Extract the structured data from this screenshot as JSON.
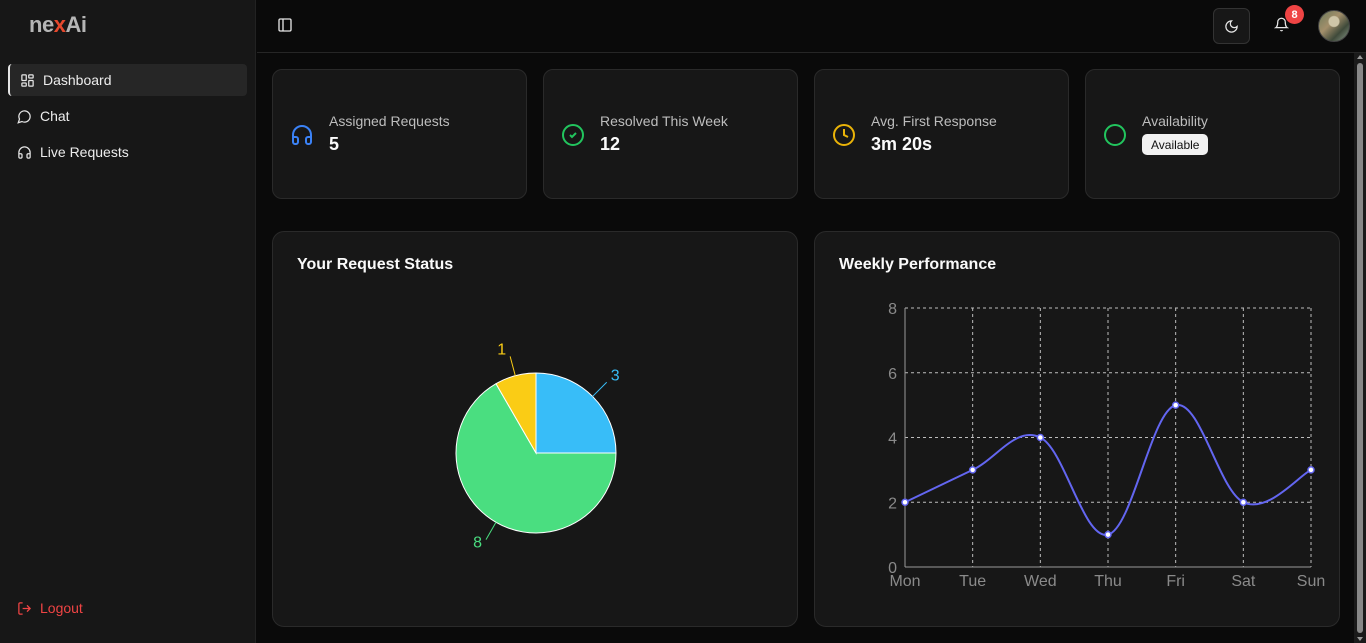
{
  "brand": {
    "prefix": "ne",
    "x": "x",
    "suffix": "Ai"
  },
  "sidebar": {
    "items": [
      {
        "label": "Dashboard",
        "icon": "dashboard-icon",
        "active": true
      },
      {
        "label": "Chat",
        "icon": "chat-icon",
        "active": false
      },
      {
        "label": "Live Requests",
        "icon": "headset-icon",
        "active": false
      }
    ],
    "logout_label": "Logout"
  },
  "topbar": {
    "notification_count": "8"
  },
  "stats": [
    {
      "label": "Assigned Requests",
      "value": "5",
      "icon": "headset-icon",
      "color": "#3b82f6"
    },
    {
      "label": "Resolved This Week",
      "value": "12",
      "icon": "check-circle-icon",
      "color": "#22c55e"
    },
    {
      "label": "Avg. First Response",
      "value": "3m 20s",
      "icon": "clock-icon",
      "color": "#eab308"
    },
    {
      "label": "Availability",
      "value": "Available",
      "icon": "circle-icon",
      "color": "#22c55e"
    }
  ],
  "charts": {
    "status_title": "Your Request Status",
    "performance_title": "Weekly Performance"
  },
  "chart_data": [
    {
      "type": "pie",
      "title": "Your Request Status",
      "values": [
        3,
        8,
        1
      ],
      "colors": [
        "#38bdf8",
        "#4ade80",
        "#facc15"
      ]
    },
    {
      "type": "line",
      "title": "Weekly Performance",
      "x": [
        "Mon",
        "Tue",
        "Wed",
        "Thu",
        "Fri",
        "Sat",
        "Sun"
      ],
      "y": [
        2,
        3,
        4,
        1,
        5,
        2,
        3
      ],
      "ylim": [
        0,
        8
      ],
      "yticks": [
        0,
        2,
        4,
        6,
        8
      ],
      "grid": true,
      "color": "#6366f1"
    }
  ]
}
